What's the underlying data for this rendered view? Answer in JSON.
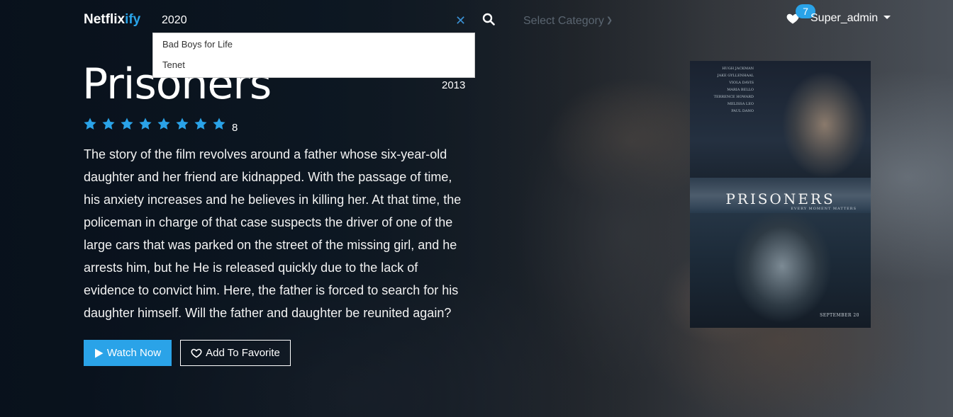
{
  "app": {
    "brand_main": "Netflix",
    "brand_accent": "ify"
  },
  "colors": {
    "accent": "#2aa3e8",
    "background": "#0e1620"
  },
  "navbar": {
    "search_value": "2020",
    "category_placeholder": "Select Category",
    "favorites_count": "7",
    "username": "Super_admin",
    "icons": [
      "close-icon",
      "search-icon",
      "chevron-down-icon",
      "heart-icon",
      "caret-down-icon"
    ]
  },
  "suggestions": [
    {
      "label": "Bad Boys for Life"
    },
    {
      "label": "Tenet"
    }
  ],
  "movie": {
    "title": "Prisoners",
    "year": "2013",
    "stars": 8,
    "rating": "8",
    "description": "The story of the film revolves around a father whose six-year-old daughter and her friend are kidnapped. With the passage of time, his anxiety increases and he believes in killing her. At that time, the policeman in charge of that case suspects the driver of one of the large cars that was parked on the street of the missing girl, and he arrests him, but he He is released quickly due to the lack of evidence to convict him. Here, the father is forced to search for his daughter himself. Will the father and daughter be reunited again?",
    "watch_label": "Watch Now",
    "favorite_label": "Add To Favorite"
  },
  "poster": {
    "title": "PRISONERS",
    "tagline": "EVERY MOMENT MATTERS",
    "release": "SEPTEMBER 20",
    "credits": [
      "HUGH JACKMAN",
      "JAKE GYLLENHAAL",
      "VIOLA DAVIS",
      "MARIA BELLO",
      "TERRENCE HOWARD",
      "MELISSA LEO",
      "PAUL DANO"
    ]
  }
}
